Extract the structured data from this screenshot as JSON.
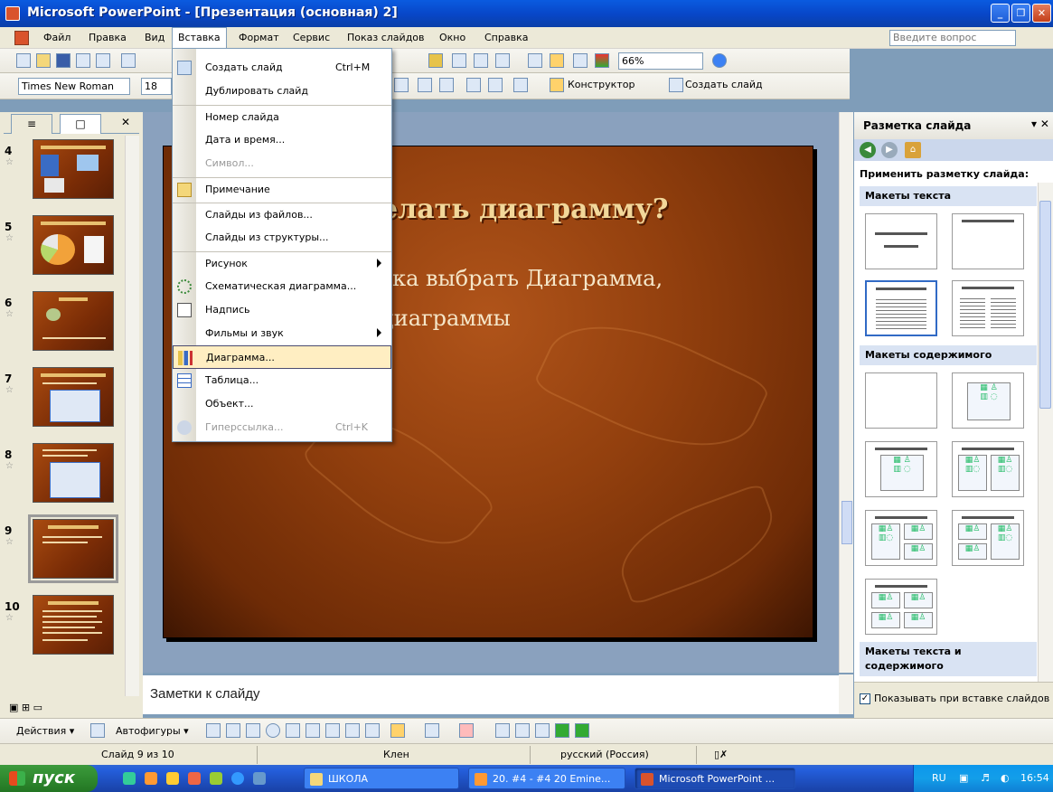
{
  "window": {
    "title": "Microsoft PowerPoint - [Презентация (основная) 2]",
    "min": "_",
    "max": "❐",
    "close": "✕"
  },
  "menubar": {
    "items": [
      "Файл",
      "Правка",
      "Вид",
      "Вставка",
      "Формат",
      "Сервис",
      "Показ слайдов",
      "Окно",
      "Справка"
    ],
    "active": "Вставка",
    "help_placeholder": "Введите вопрос"
  },
  "toolbar": {
    "zoom": "66%",
    "font": "Times New Roman",
    "font_size": "18",
    "designer": "Конструктор",
    "new_slide": "Создать слайд"
  },
  "insert_menu": {
    "items": [
      {
        "label": "Создать слайд",
        "shortcut": "Ctrl+M",
        "icon": "new-slide-icon"
      },
      {
        "label": "Дублировать слайд",
        "shortcut": "",
        "icon": ""
      },
      {
        "label": "Номер слайда",
        "shortcut": "",
        "icon": ""
      },
      {
        "label": "Дата и время...",
        "shortcut": "",
        "icon": ""
      },
      {
        "label": "Символ...",
        "shortcut": "",
        "icon": "",
        "disabled": true
      },
      {
        "label": "Примечание",
        "shortcut": "",
        "icon": "comment-icon"
      },
      {
        "label": "Слайды из файлов...",
        "shortcut": "",
        "icon": ""
      },
      {
        "label": "Слайды из структуры...",
        "shortcut": "",
        "icon": ""
      },
      {
        "label": "Рисунок",
        "shortcut": "",
        "icon": "",
        "submenu": true
      },
      {
        "label": "Схематическая диаграмма...",
        "shortcut": "",
        "icon": "diagram-icon"
      },
      {
        "label": "Надпись",
        "shortcut": "",
        "icon": "textbox-icon"
      },
      {
        "label": "Фильмы и звук",
        "shortcut": "",
        "icon": "",
        "submenu": true
      },
      {
        "label": "Диаграмма...",
        "shortcut": "",
        "icon": "chart-icon",
        "highlighted": true
      },
      {
        "label": "Таблица...",
        "shortcut": "",
        "icon": "table-icon"
      },
      {
        "label": "Объект...",
        "shortcut": "",
        "icon": ""
      },
      {
        "label": "Гиперссылка...",
        "shortcut": "Ctrl+K",
        "icon": "hyperlink-icon",
        "disabled": true
      }
    ]
  },
  "thumbnails": {
    "numbers": [
      "4",
      "5",
      "6",
      "7",
      "8",
      "9",
      "10"
    ],
    "selected": "9"
  },
  "slide": {
    "title_visible": "елать диаграмму?",
    "body_line1": "зка выбрать Диаграмма,",
    "body_line2": "диаграммы"
  },
  "notes": {
    "placeholder": "Заметки к слайду"
  },
  "taskpane": {
    "title": "Разметка слайда",
    "apply": "Применить разметку слайда:",
    "section_text": "Макеты текста",
    "section_content": "Макеты содержимого",
    "section_text_content": "Макеты текста и содержимого",
    "show_on_insert": "Показывать при вставке слайдов"
  },
  "drawbar": {
    "actions": "Действия ▾",
    "autoshapes": "Автофигуры ▾"
  },
  "status": {
    "slide": "Слайд 9 из 10",
    "design": "Клен",
    "language": "русский (Россия)"
  },
  "taskbar": {
    "start": "пуск",
    "tasks": [
      "ШКОЛА",
      "20. #4 - #4 20 Emine...",
      "Microsoft PowerPoint ..."
    ],
    "lang": "RU",
    "time": "16:54"
  },
  "colors": {
    "accent": "#0a5be0",
    "highlight": "#ffeec2",
    "slide_bg": "#93400e"
  }
}
